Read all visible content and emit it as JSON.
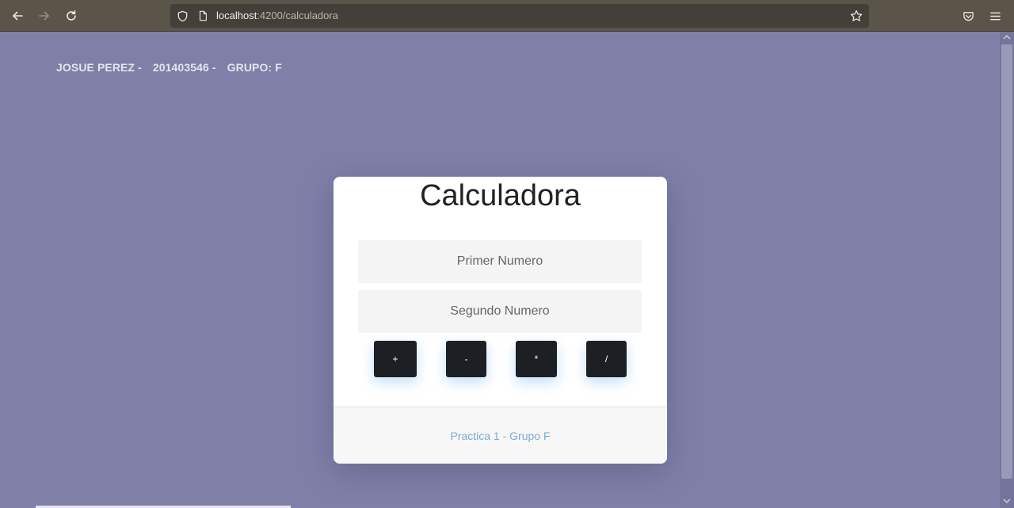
{
  "browser": {
    "url_host": "localhost",
    "url_path": ":4200/calculadora"
  },
  "header": {
    "name": "JOSUE PEREZ -",
    "carnet": "201403546 -",
    "group": "GRUPO: F"
  },
  "calculator": {
    "title": "Calculadora",
    "first_number_placeholder": "Primer Numero",
    "second_number_placeholder": "Segundo Numero",
    "buttons": {
      "add": "+",
      "subtract": "-",
      "multiply": "*",
      "divide": "/"
    },
    "footer_text": "Practica 1 - Grupo F"
  },
  "colors": {
    "page_background": "#7f7fa8",
    "button_background": "#1c2024",
    "footer_link": "#7ea9d6"
  }
}
